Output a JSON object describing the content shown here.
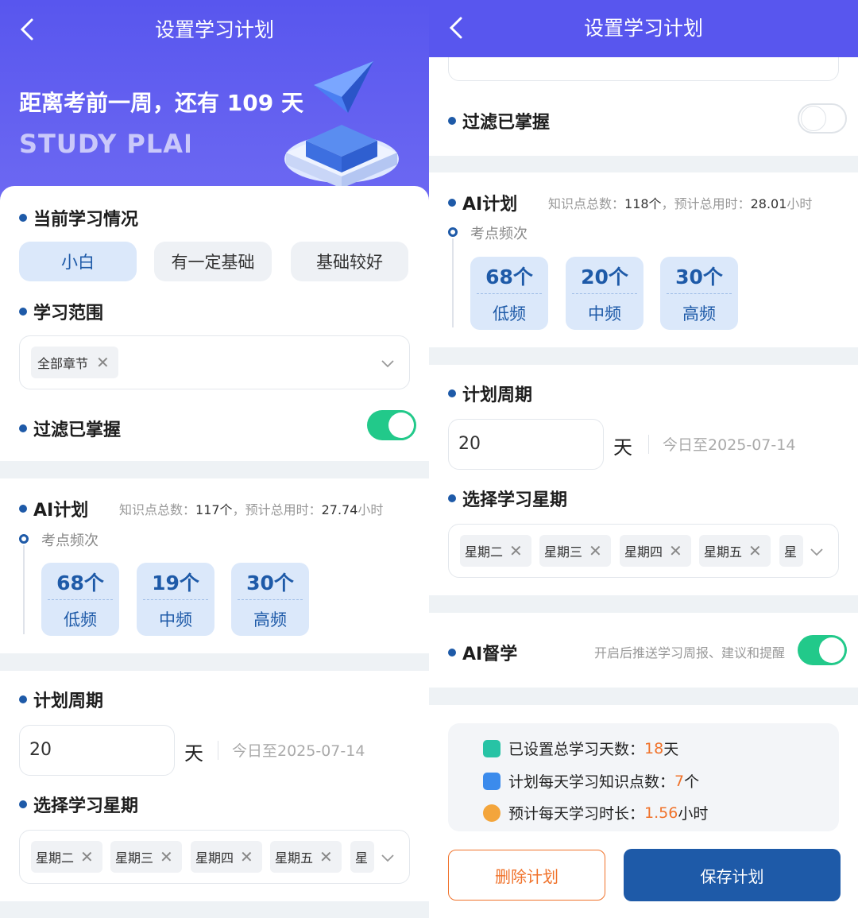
{
  "left": {
    "header": {
      "title": "设置学习计划"
    },
    "hero": {
      "countdown": "距离考前一周，还有 109 天",
      "subtitle": "STUDY PLAN"
    },
    "current_status": {
      "title": "当前学习情况",
      "options": [
        "小白",
        "有一定基础",
        "基础较好"
      ],
      "selected": "小白"
    },
    "scope": {
      "title": "学习范围",
      "tag": "全部章节"
    },
    "filter": {
      "title": "过滤已掌握",
      "enabled": true
    },
    "ai_plan": {
      "title": "AI计划",
      "meta_label1": "知识点总数：",
      "meta_value1": "117个",
      "meta_sep": "，",
      "meta_label2": "预计总用时：",
      "meta_value2": "27.74",
      "meta_unit2": "小时",
      "freq_label": "考点频次",
      "freq": [
        {
          "count": "68个",
          "label": "低频"
        },
        {
          "count": "19个",
          "label": "中频"
        },
        {
          "count": "30个",
          "label": "高频"
        }
      ]
    },
    "period": {
      "title": "计划周期",
      "days": "20",
      "unit": "天",
      "range": "今日至2025-07-14"
    },
    "weekdays": {
      "title": "选择学习星期",
      "tags": [
        "星期二",
        "星期三",
        "星期四",
        "星期五",
        "星"
      ]
    }
  },
  "right": {
    "header": {
      "title": "设置学习计划"
    },
    "filter": {
      "title": "过滤已掌握",
      "enabled": false
    },
    "ai_plan": {
      "title": "AI计划",
      "meta_label1": "知识点总数：",
      "meta_value1": "118个",
      "meta_sep": "，",
      "meta_label2": "预计总用时：",
      "meta_value2": "28.01",
      "meta_unit2": "小时",
      "freq_label": "考点频次",
      "freq": [
        {
          "count": "68个",
          "label": "低频"
        },
        {
          "count": "20个",
          "label": "中频"
        },
        {
          "count": "30个",
          "label": "高频"
        }
      ]
    },
    "period": {
      "title": "计划周期",
      "days": "20",
      "unit": "天",
      "range": "今日至2025-07-14"
    },
    "weekdays": {
      "title": "选择学习星期",
      "tags": [
        "星期二",
        "星期三",
        "星期四",
        "星期五",
        "星"
      ]
    },
    "ai_supervise": {
      "title": "AI督学",
      "desc": "开启后推送学习周报、建议和提醒",
      "enabled": true
    },
    "summary": {
      "rows": [
        {
          "label": "已设置总学习天数：",
          "value": "18",
          "unit": "天",
          "icon": "calendar-icon",
          "color": "#27c3a5"
        },
        {
          "label": "计划每天学习知识点数：",
          "value": "7",
          "unit": "个",
          "icon": "book-icon",
          "color": "#3b8bec"
        },
        {
          "label": "预计每天学习时长：",
          "value": "1.56",
          "unit": "小时",
          "icon": "clock-icon",
          "color": "#f3a53c"
        }
      ]
    },
    "actions": {
      "delete": "删除计划",
      "save": "保存计划"
    }
  },
  "colors": {
    "header": "#5856ee",
    "primary": "#1e5aa8",
    "toggle_on": "#22c98a",
    "accent": "#f0722a",
    "chip_active": "#dbe8fa"
  }
}
